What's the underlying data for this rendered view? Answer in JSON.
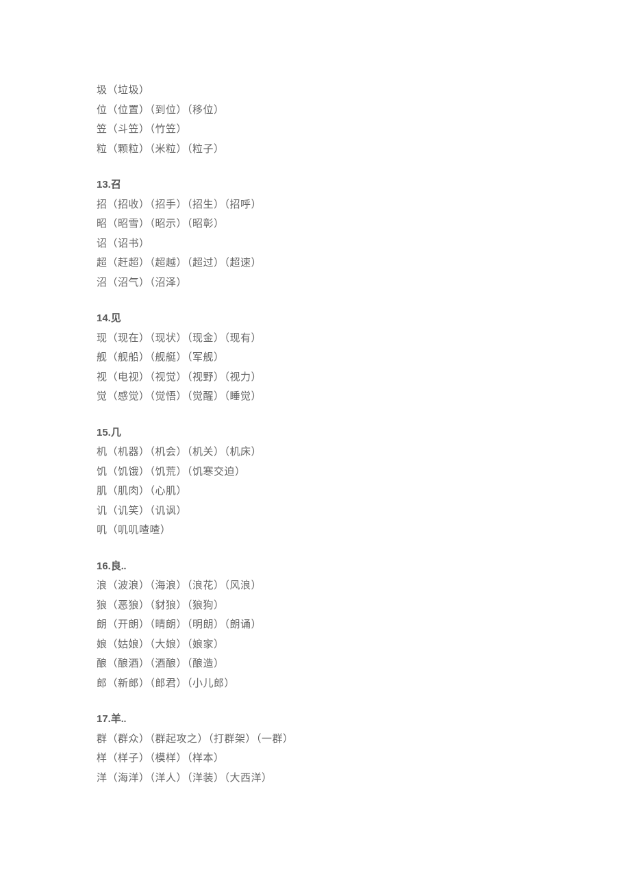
{
  "sections": [
    {
      "heading": null,
      "lines": [
        "圾（垃圾）",
        "位（位置）（到位）（移位）",
        "笠（斗笠）（竹笠）",
        "粒（颗粒）（米粒）（粒子）"
      ]
    },
    {
      "heading": "13.召",
      "lines": [
        "招（招收）（招手）（招生）（招呼）",
        "昭（昭雪）（昭示）（昭彰）",
        "诏（诏书）",
        "超（赶超）（超越）（超过）（超速）",
        "沼（沼气）（沼泽）"
      ]
    },
    {
      "heading": "14.见",
      "lines": [
        "现（现在）（现状）（现金）（现有）",
        "舰（舰船）（舰艇）（军舰）",
        "视（电视）（视觉）（视野）（视力）",
        "觉（感觉）（觉悟）（觉醒）（睡觉）"
      ]
    },
    {
      "heading": "15.几",
      "lines": [
        "机（机器）（机会）（机关）（机床）",
        "饥（饥饿）（饥荒）（饥寒交迫）",
        "肌（肌肉）（心肌）",
        "讥（讥笑）（讥讽）",
        "叽（叽叽喳喳）"
      ]
    },
    {
      "heading": "16.良..",
      "lines": [
        "浪（波浪）（海浪）（浪花）（风浪）",
        "狼（恶狼）（豺狼）（狼狗）",
        "朗（开朗）（晴朗）（明朗）（朗诵）",
        "娘（姑娘）（大娘）（娘家）",
        "酿（酿酒）（酒酿）（酿造）",
        "郎（新郎）（郎君）（小儿郎）"
      ]
    },
    {
      "heading": "17.羊..",
      "lines": [
        "群（群众）（群起攻之）（打群架）（一群）",
        "样（样子）（模样）（样本）",
        "洋（海洋）（洋人）（洋装）（大西洋）"
      ]
    }
  ]
}
